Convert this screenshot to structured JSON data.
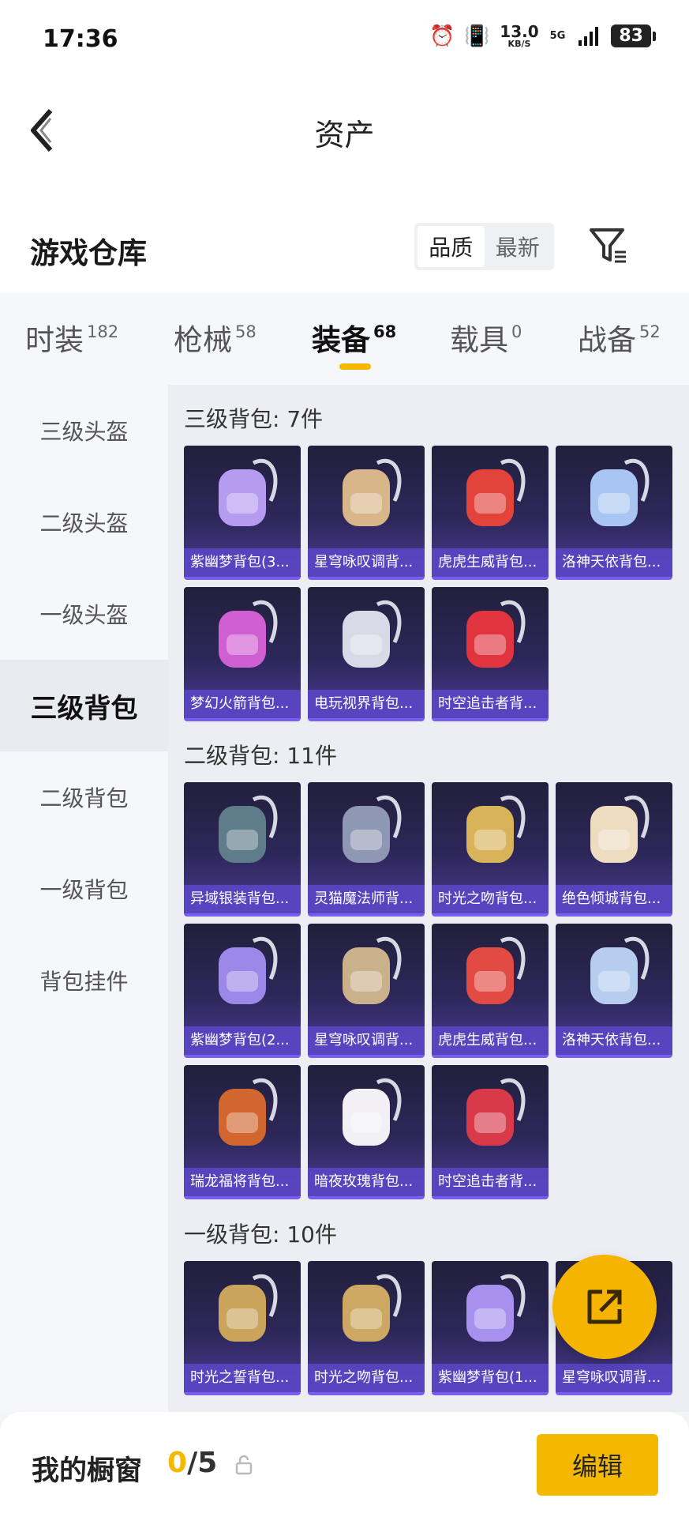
{
  "status_bar": {
    "time": "17:36",
    "speed_value": "13.0",
    "speed_unit": "KB/S",
    "network": "5G",
    "battery": "83"
  },
  "nav": {
    "title": "资产"
  },
  "warehouse": {
    "title": "游戏仓库",
    "sort_options": [
      "品质",
      "最新"
    ],
    "active_sort": "品质"
  },
  "tabs": [
    {
      "label": "时装",
      "count": "182"
    },
    {
      "label": "枪械",
      "count": "58"
    },
    {
      "label": "装备",
      "count": "68",
      "active": true
    },
    {
      "label": "载具",
      "count": "0"
    },
    {
      "label": "战备",
      "count": "52"
    }
  ],
  "sidebar": {
    "items": [
      "三级头盔",
      "二级头盔",
      "一级头盔",
      "三级背包",
      "二级背包",
      "一级背包",
      "背包挂件"
    ],
    "active": "三级背包"
  },
  "sections": [
    {
      "title": "三级背包: 7件",
      "items": [
        {
          "name": "紫幽梦背包(3...",
          "color": "#b59cf0"
        },
        {
          "name": "星穹咏叹调背...",
          "color": "#d9b68a"
        },
        {
          "name": "虎虎生威背包...",
          "color": "#e2433b"
        },
        {
          "name": "洛神天依背包...",
          "color": "#a9c6f2"
        },
        {
          "name": "梦幻火箭背包...",
          "color": "#d05fd4"
        },
        {
          "name": "电玩视界背包...",
          "color": "#d9d9e8"
        },
        {
          "name": "时空追击者背...",
          "color": "#e0343f"
        }
      ]
    },
    {
      "title": "二级背包: 11件",
      "items": [
        {
          "name": "异域银装背包...",
          "color": "#5e7c8a"
        },
        {
          "name": "灵猫魔法师背...",
          "color": "#8e98b4"
        },
        {
          "name": "时光之吻背包...",
          "color": "#d8b35a"
        },
        {
          "name": "绝色倾城背包...",
          "color": "#eddcc0"
        },
        {
          "name": "紫幽梦背包(2...",
          "color": "#9c88e8"
        },
        {
          "name": "星穹咏叹调背...",
          "color": "#cbb08c"
        },
        {
          "name": "虎虎生威背包...",
          "color": "#e24a44"
        },
        {
          "name": "洛神天依背包...",
          "color": "#b7cdf0"
        },
        {
          "name": "瑞龙福将背包...",
          "color": "#d2662f"
        },
        {
          "name": "暗夜玫瑰背包...",
          "color": "#f2f0f4"
        },
        {
          "name": "时空追击者背...",
          "color": "#d93a4a"
        }
      ]
    },
    {
      "title": "一级背包: 10件",
      "items": [
        {
          "name": "时光之誓背包...",
          "color": "#c9a45a"
        },
        {
          "name": "时光之吻背包...",
          "color": "#cda862"
        },
        {
          "name": "紫幽梦背包(1...",
          "color": "#a890ee"
        },
        {
          "name": "星穹咏叹调背...",
          "color": "#cbb08c"
        }
      ]
    }
  ],
  "bottom": {
    "label": "我的橱窗",
    "current": "0",
    "total": "/5",
    "edit": "编辑"
  },
  "colors": {
    "accent": "#f5b800",
    "card_bottom": "#5c46c8"
  }
}
